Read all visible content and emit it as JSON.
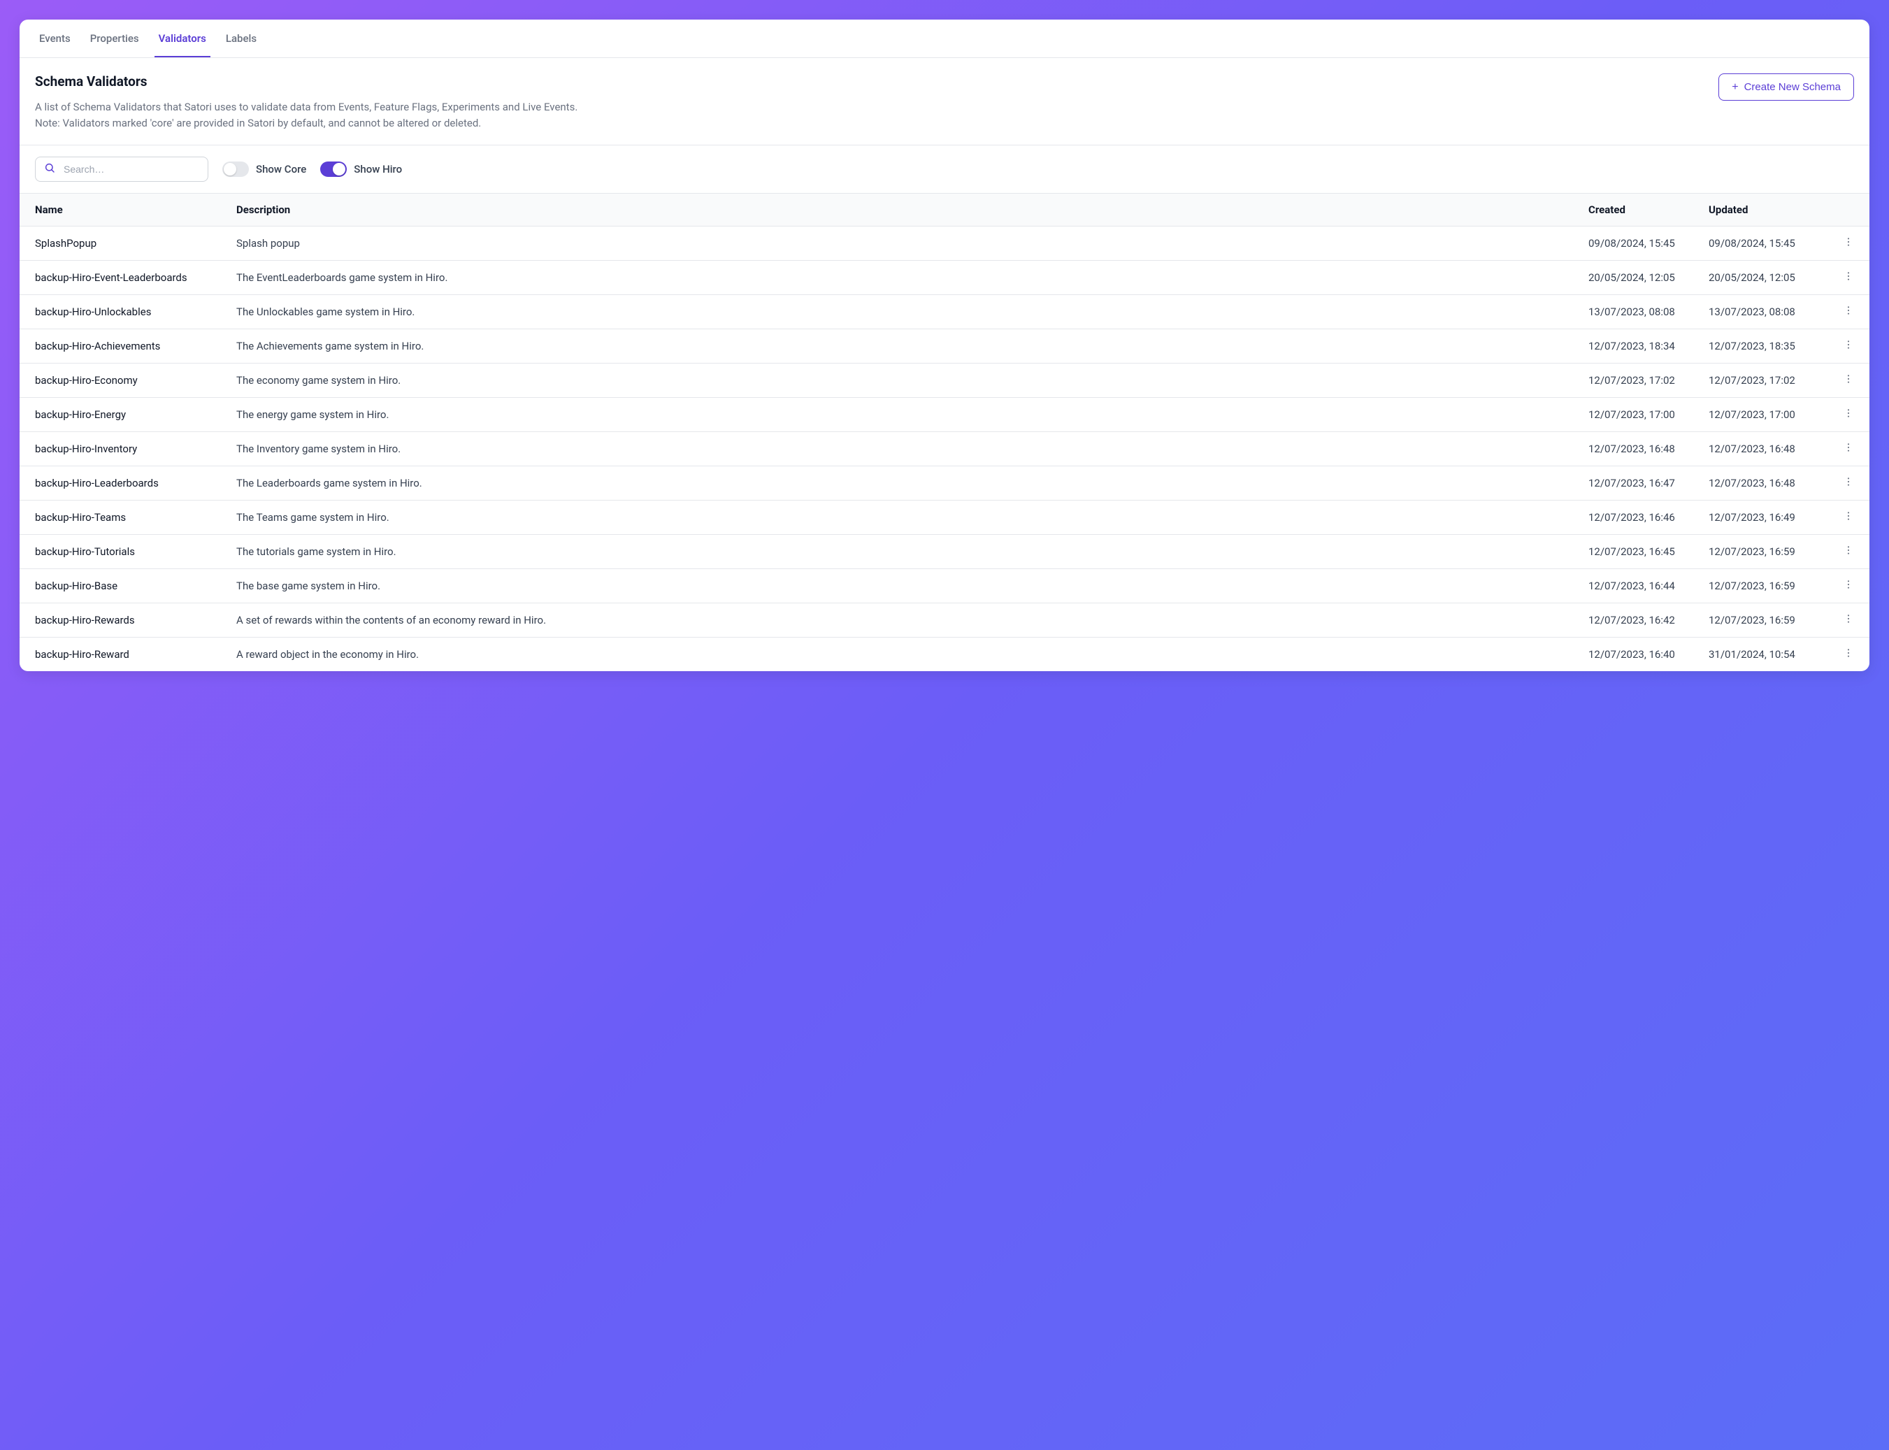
{
  "tabs": {
    "events": "Events",
    "properties": "Properties",
    "validators": "Validators",
    "labels": "Labels",
    "active": "validators"
  },
  "header": {
    "title": "Schema Validators",
    "desc_line1": "A list of Schema Validators that Satori uses to validate data from Events, Feature Flags, Experiments and Live Events.",
    "desc_line2": "Note: Validators marked 'core' are provided in Satori by default, and cannot be altered or deleted.",
    "create_button": "Create New Schema"
  },
  "filters": {
    "search_placeholder": "Search…",
    "show_core_label": "Show Core",
    "show_core_on": false,
    "show_hiro_label": "Show Hiro",
    "show_hiro_on": true
  },
  "columns": {
    "name": "Name",
    "description": "Description",
    "created": "Created",
    "updated": "Updated"
  },
  "rows": [
    {
      "name": "SplashPopup",
      "description": "Splash popup",
      "created": "09/08/2024, 15:45",
      "updated": "09/08/2024, 15:45"
    },
    {
      "name": "backup-Hiro-Event-Leaderboards",
      "description": "The EventLeaderboards game system in Hiro.",
      "created": "20/05/2024, 12:05",
      "updated": "20/05/2024, 12:05"
    },
    {
      "name": "backup-Hiro-Unlockables",
      "description": "The Unlockables game system in Hiro.",
      "created": "13/07/2023, 08:08",
      "updated": "13/07/2023, 08:08"
    },
    {
      "name": "backup-Hiro-Achievements",
      "description": "The Achievements game system in Hiro.",
      "created": "12/07/2023, 18:34",
      "updated": "12/07/2023, 18:35"
    },
    {
      "name": "backup-Hiro-Economy",
      "description": "The economy game system in Hiro.",
      "created": "12/07/2023, 17:02",
      "updated": "12/07/2023, 17:02"
    },
    {
      "name": "backup-Hiro-Energy",
      "description": "The energy game system in Hiro.",
      "created": "12/07/2023, 17:00",
      "updated": "12/07/2023, 17:00"
    },
    {
      "name": "backup-Hiro-Inventory",
      "description": "The Inventory game system in Hiro.",
      "created": "12/07/2023, 16:48",
      "updated": "12/07/2023, 16:48"
    },
    {
      "name": "backup-Hiro-Leaderboards",
      "description": "The Leaderboards game system in Hiro.",
      "created": "12/07/2023, 16:47",
      "updated": "12/07/2023, 16:48"
    },
    {
      "name": "backup-Hiro-Teams",
      "description": "The Teams game system in Hiro.",
      "created": "12/07/2023, 16:46",
      "updated": "12/07/2023, 16:49"
    },
    {
      "name": "backup-Hiro-Tutorials",
      "description": "The tutorials game system in Hiro.",
      "created": "12/07/2023, 16:45",
      "updated": "12/07/2023, 16:59"
    },
    {
      "name": "backup-Hiro-Base",
      "description": "The base game system in Hiro.",
      "created": "12/07/2023, 16:44",
      "updated": "12/07/2023, 16:59"
    },
    {
      "name": "backup-Hiro-Rewards",
      "description": "A set of rewards within the contents of an economy reward in Hiro.",
      "created": "12/07/2023, 16:42",
      "updated": "12/07/2023, 16:59"
    },
    {
      "name": "backup-Hiro-Reward",
      "description": "A reward object in the economy in Hiro.",
      "created": "12/07/2023, 16:40",
      "updated": "31/01/2024, 10:54"
    }
  ]
}
